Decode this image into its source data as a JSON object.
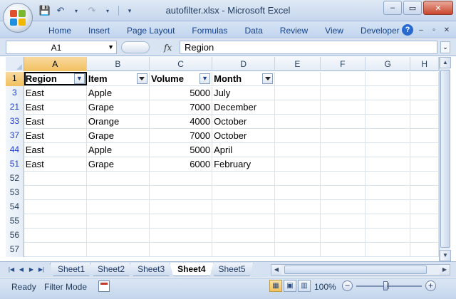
{
  "window": {
    "title": "autofilter.xlsx - Microsoft Excel",
    "controls": {
      "minimize": "–",
      "restore": "▭",
      "close": "✕"
    }
  },
  "qat": {
    "save": "💾",
    "undo": "↶",
    "redo": "↷"
  },
  "ribbon": {
    "tabs": [
      "Home",
      "Insert",
      "Page Layout",
      "Formulas",
      "Data",
      "Review",
      "View",
      "Developer"
    ],
    "help": "?"
  },
  "formula_bar": {
    "name_box": "A1",
    "fx": "fx",
    "value": "Region"
  },
  "grid": {
    "active_column": "A",
    "columns": [
      "A",
      "B",
      "C",
      "D",
      "E",
      "F",
      "G",
      "H"
    ],
    "header_row": {
      "row_number": "1",
      "cells": [
        "Region",
        "Item",
        "Volume",
        "Month"
      ],
      "filter_active": [
        true,
        false,
        true,
        false
      ]
    },
    "rows": [
      {
        "row_number": "3",
        "region": "East",
        "item": "Apple",
        "volume": "5000",
        "month": "July"
      },
      {
        "row_number": "21",
        "region": "East",
        "item": "Grape",
        "volume": "7000",
        "month": "December"
      },
      {
        "row_number": "33",
        "region": "East",
        "item": "Orange",
        "volume": "4000",
        "month": "October"
      },
      {
        "row_number": "37",
        "region": "East",
        "item": "Grape",
        "volume": "7000",
        "month": "October"
      },
      {
        "row_number": "44",
        "region": "East",
        "item": "Apple",
        "volume": "5000",
        "month": "April"
      },
      {
        "row_number": "51",
        "region": "East",
        "item": "Grape",
        "volume": "6000",
        "month": "February"
      }
    ],
    "empty_rows": [
      "52",
      "53",
      "54",
      "55",
      "56",
      "57"
    ]
  },
  "sheets": {
    "tabs": [
      "Sheet1",
      "Sheet2",
      "Sheet3",
      "Sheet4",
      "Sheet5"
    ],
    "active": "Sheet4"
  },
  "status": {
    "ready": "Ready",
    "mode": "Filter Mode",
    "zoom": "100%"
  }
}
